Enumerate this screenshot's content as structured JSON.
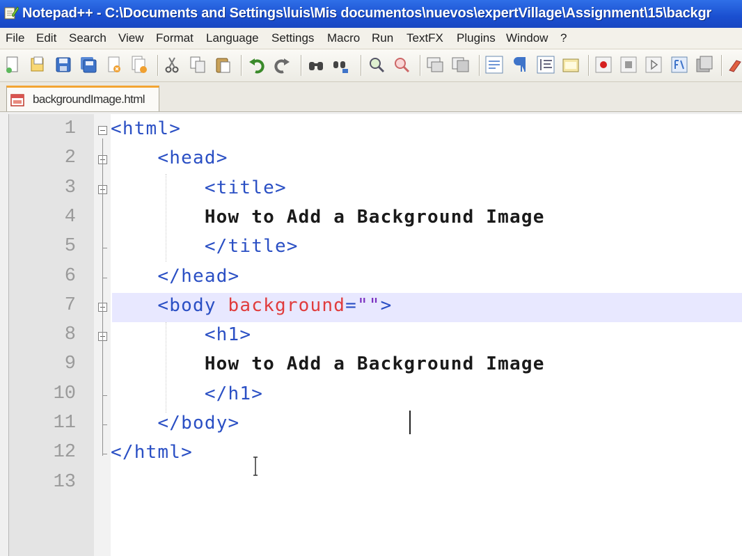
{
  "titlebar": {
    "title": "Notepad++ - C:\\Documents and Settings\\luis\\Mis documentos\\nuevos\\expertVillage\\Assignment\\15\\backgr",
    "app_icon": "notepad-icon",
    "bg_color": "#1a4fd0"
  },
  "menu": {
    "items": [
      {
        "label": "File"
      },
      {
        "label": "Edit"
      },
      {
        "label": "Search"
      },
      {
        "label": "View"
      },
      {
        "label": "Format"
      },
      {
        "label": "Language"
      },
      {
        "label": "Settings"
      },
      {
        "label": "Macro"
      },
      {
        "label": "Run"
      },
      {
        "label": "TextFX"
      },
      {
        "label": "Plugins"
      },
      {
        "label": "Window"
      },
      {
        "label": "?"
      }
    ]
  },
  "toolbar": {
    "buttons": [
      "new-file-icon",
      "open-file-icon",
      "save-icon",
      "save-all-icon",
      "close-icon",
      "close-all-icon",
      "cut-icon",
      "copy-icon",
      "paste-icon",
      "undo-icon",
      "redo-icon",
      "find-icon",
      "replace-icon",
      "zoom-in-icon",
      "zoom-out-icon",
      "sync-vertical-icon",
      "sync-horizontal-icon",
      "word-wrap-icon",
      "show-all-characters-icon",
      "indent-guide-icon",
      "user-language-icon",
      "record-macro-icon",
      "stop-recording-icon",
      "play-macro-icon",
      "run-macro-multiple-icon",
      "save-macro-icon",
      "spell-check-icon"
    ]
  },
  "tab": {
    "label": "backgroundImage.html",
    "icon": "html-file-icon",
    "accent_color": "#f3a533"
  },
  "editor": {
    "current_line": 7,
    "lines": [
      {
        "number": "1",
        "tokens": [
          {
            "t": "tag",
            "v": "<html>"
          }
        ]
      },
      {
        "number": "2",
        "tokens": [
          {
            "t": "ws",
            "v": "    "
          },
          {
            "t": "tag",
            "v": "<head>"
          }
        ]
      },
      {
        "number": "3",
        "tokens": [
          {
            "t": "ws",
            "v": "        "
          },
          {
            "t": "tag",
            "v": "<title>"
          }
        ]
      },
      {
        "number": "4",
        "tokens": [
          {
            "t": "ws",
            "v": "        "
          },
          {
            "t": "text",
            "v": "How to Add a Background Image"
          }
        ]
      },
      {
        "number": "5",
        "tokens": [
          {
            "t": "ws",
            "v": "        "
          },
          {
            "t": "tag",
            "v": "</title>"
          }
        ]
      },
      {
        "number": "6",
        "tokens": [
          {
            "t": "ws",
            "v": "    "
          },
          {
            "t": "tag",
            "v": "</head>"
          }
        ]
      },
      {
        "number": "7",
        "tokens": [
          {
            "t": "ws",
            "v": "    "
          },
          {
            "t": "tag",
            "v": "<body "
          },
          {
            "t": "attr",
            "v": "background"
          },
          {
            "t": "tag",
            "v": "="
          },
          {
            "t": "val",
            "v": "\"\""
          },
          {
            "t": "tag",
            "v": ">"
          }
        ]
      },
      {
        "number": "8",
        "tokens": [
          {
            "t": "ws",
            "v": "        "
          },
          {
            "t": "tag",
            "v": "<h1>"
          }
        ]
      },
      {
        "number": "9",
        "tokens": [
          {
            "t": "ws",
            "v": "        "
          },
          {
            "t": "text",
            "v": "How to Add a Background Image"
          }
        ]
      },
      {
        "number": "10",
        "tokens": [
          {
            "t": "ws",
            "v": "        "
          },
          {
            "t": "tag",
            "v": "</h1>"
          }
        ]
      },
      {
        "number": "11",
        "tokens": [
          {
            "t": "ws",
            "v": "    "
          },
          {
            "t": "tag",
            "v": "</body>"
          }
        ]
      },
      {
        "number": "12",
        "tokens": [
          {
            "t": "tag",
            "v": "</html>"
          }
        ]
      },
      {
        "number": "13",
        "tokens": []
      }
    ],
    "colors": {
      "tag": "#2a4fc4",
      "attr": "#e03c3c",
      "text": "#1a1a1a",
      "current_line_bg": "#e8e8ff"
    }
  }
}
